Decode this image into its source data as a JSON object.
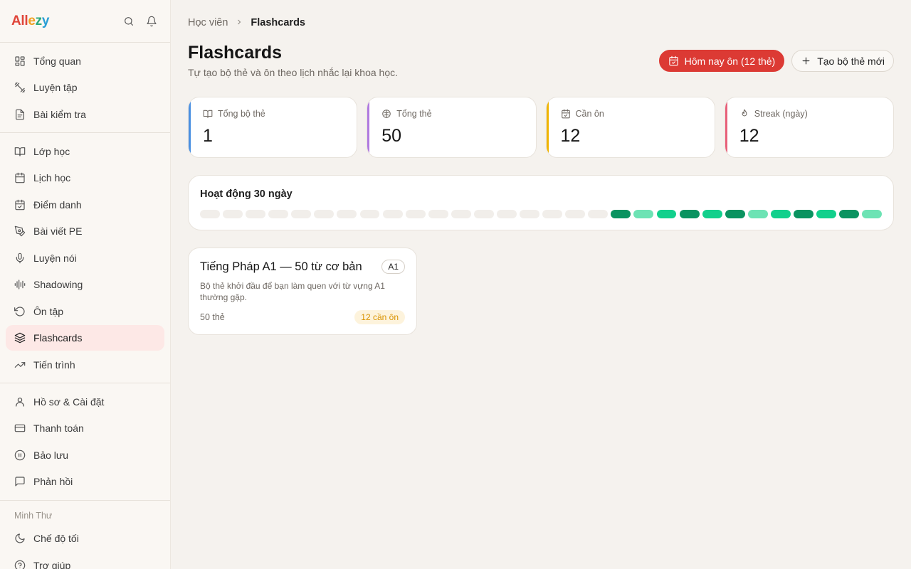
{
  "brand": {
    "logo_parts": [
      "All",
      "e",
      "z",
      "y"
    ]
  },
  "sidebar": {
    "groups": [
      [
        {
          "label": "Tổng quan",
          "icon": "grid-icon"
        },
        {
          "label": "Luyện tập",
          "icon": "dumbbell-icon"
        },
        {
          "label": "Bài kiểm tra",
          "icon": "document-icon"
        }
      ],
      [
        {
          "label": "Lớp học",
          "icon": "book-open-icon"
        },
        {
          "label": "Lịch học",
          "icon": "calendar-icon"
        },
        {
          "label": "Điểm danh",
          "icon": "calendar-check-icon"
        },
        {
          "label": "Bài viết PE",
          "icon": "pen-icon"
        },
        {
          "label": "Luyện nói",
          "icon": "mic-icon"
        },
        {
          "label": "Shadowing",
          "icon": "waveform-icon"
        },
        {
          "label": "Ôn tập",
          "icon": "rotate-ccw-icon"
        },
        {
          "label": "Flashcards",
          "icon": "layers-icon",
          "active": true
        },
        {
          "label": "Tiến trình",
          "icon": "trending-up-icon"
        }
      ],
      [
        {
          "label": "Hồ sơ & Cài đặt",
          "icon": "user-icon"
        },
        {
          "label": "Thanh toán",
          "icon": "credit-card-icon"
        },
        {
          "label": "Bảo lưu",
          "icon": "pause-circle-icon"
        },
        {
          "label": "Phản hồi",
          "icon": "message-square-icon"
        }
      ]
    ],
    "user_name": "Minh Thư",
    "footer_items": [
      {
        "label": "Chế độ tối",
        "icon": "moon-icon"
      },
      {
        "label": "Trợ giúp",
        "icon": "help-circle-icon"
      }
    ]
  },
  "breadcrumb": {
    "parent": "Học viên",
    "current": "Flashcards"
  },
  "page": {
    "title": "Flashcards",
    "subtitle": "Tự tạo bộ thẻ và ôn theo lịch nhắc lại khoa học."
  },
  "actions": {
    "review_today": "Hôm nay ôn (12 thẻ)",
    "create_deck": "Tạo bộ thẻ mới"
  },
  "stats": [
    {
      "label": "Tổng bộ thẻ",
      "value": "1",
      "icon": "book-open-icon",
      "accent": "#4a90e2"
    },
    {
      "label": "Tổng thẻ",
      "value": "50",
      "icon": "brain-icon",
      "accent": "#b07ae0"
    },
    {
      "label": "Cần ôn",
      "value": "12",
      "icon": "calendar-check-icon",
      "accent": "#f0b400"
    },
    {
      "label": "Streak (ngày)",
      "value": "12",
      "icon": "flame-icon",
      "accent": "#e8607a"
    }
  ],
  "activity": {
    "title": "Hoạt động 30 ngày",
    "levels": [
      0,
      0,
      0,
      0,
      0,
      0,
      0,
      0,
      0,
      0,
      0,
      0,
      0,
      0,
      0,
      0,
      0,
      0,
      3,
      1,
      2,
      3,
      2,
      3,
      1,
      2,
      3,
      2,
      3,
      1
    ],
    "colors": {
      "0": "#f1eeea",
      "1": "#6de3b4",
      "2": "#12d08c",
      "3": "#0a9360"
    }
  },
  "deck": {
    "title": "Tiếng Pháp A1 — 50 từ cơ bản",
    "level": "A1",
    "description": "Bộ thẻ khởi đầu để bạn làm quen với từ vựng A1 thường gặp.",
    "count": "50 thẻ",
    "due": "12 cần ôn"
  },
  "colors": {
    "accent_red": "#dc3a34",
    "active_nav_bg": "#fde8e6"
  }
}
